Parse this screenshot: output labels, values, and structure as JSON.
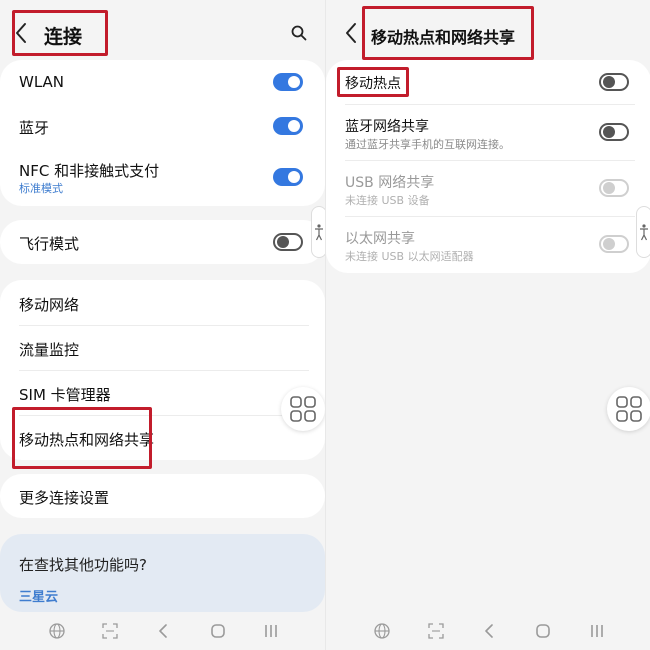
{
  "left": {
    "title": "连接",
    "card1": [
      {
        "label": "WLAN",
        "toggle": "on"
      },
      {
        "label": "蓝牙",
        "toggle": "on"
      },
      {
        "label": "NFC 和非接触式支付",
        "sub": "标准模式",
        "toggle": "on"
      }
    ],
    "card2": [
      {
        "label": "飞行模式",
        "toggle": "off"
      }
    ],
    "card3": [
      {
        "label": "移动网络"
      },
      {
        "label": "流量监控"
      },
      {
        "label": "SIM 卡管理器"
      },
      {
        "label": "移动热点和网络共享"
      }
    ],
    "card4": [
      {
        "label": "更多连接设置"
      }
    ],
    "tip": {
      "question": "在查找其他功能吗?",
      "link": "三星云"
    }
  },
  "right": {
    "title": "移动热点和网络共享",
    "items": [
      {
        "label": "移动热点",
        "toggle": "off",
        "enabled": true
      },
      {
        "label": "蓝牙网络共享",
        "sub": "通过蓝牙共享手机的互联网连接。",
        "toggle": "off",
        "enabled": true
      },
      {
        "label": "USB 网络共享",
        "sub": "未连接 USB 设备",
        "toggle": "off",
        "enabled": false
      },
      {
        "label": "以太网共享",
        "sub": "未连接 USB 以太网适配器",
        "toggle": "off",
        "enabled": false
      }
    ]
  },
  "icons": {
    "back": "chevron-left-icon",
    "search": "search-icon",
    "apps": "four-squares-icon",
    "accessibility": "accessibility-icon",
    "nav": [
      "globe-icon",
      "scan-icon",
      "back-nav-icon",
      "home-nav-icon",
      "recents-nav-icon"
    ]
  },
  "colors": {
    "accent": "#3478e0",
    "highlight_box": "#c21c2b",
    "link": "#3f7dcf"
  }
}
